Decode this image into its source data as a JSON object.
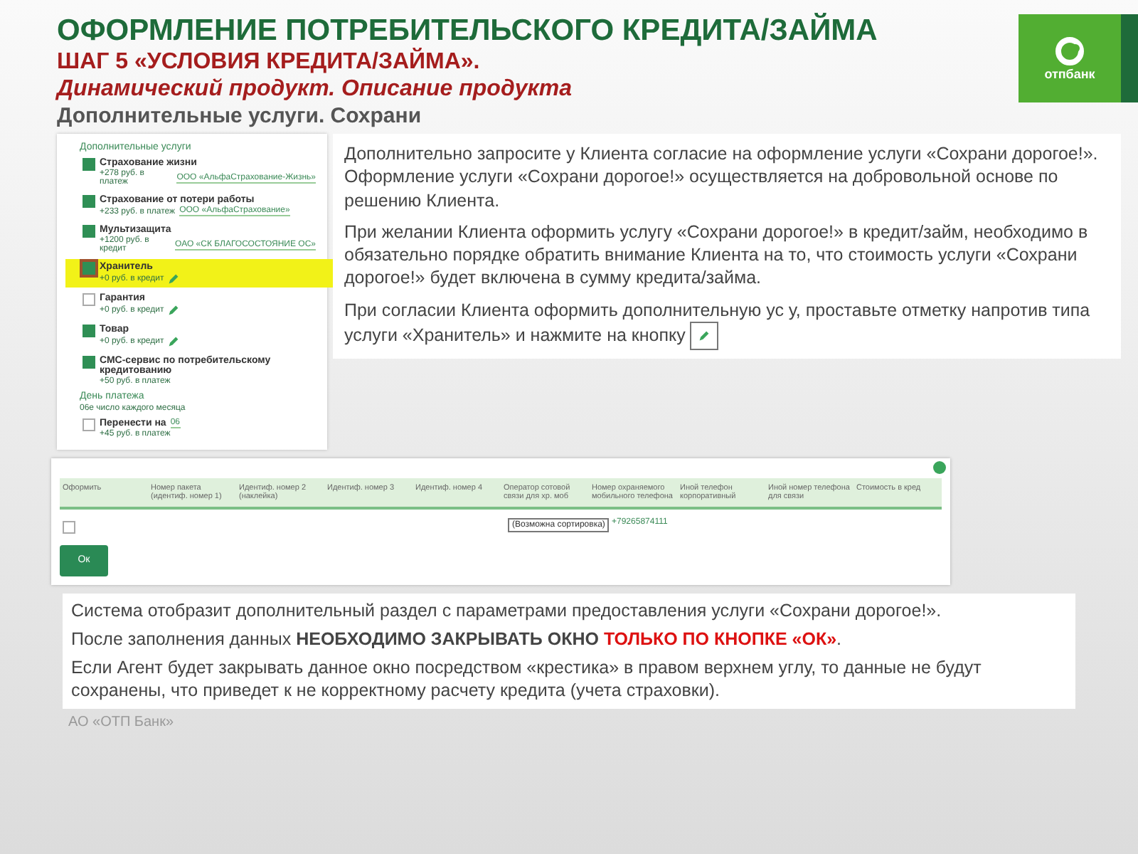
{
  "header": {
    "title": "ОФОРМЛЕНИЕ ПОТРЕБИТЕЛЬСКОГО КРЕДИТА/ЗАЙМА",
    "step": "ШАГ 5 «УСЛОВИЯ КРЕДИТА/ЗАЙМА».",
    "subtitle": "Динамический продукт. Описание продукта",
    "section": "Дополнительные услуги. Сохрани",
    "logo_text": "отпбанк"
  },
  "services_panel": {
    "heading": "Дополнительные услуги",
    "items": [
      {
        "name": "Страхование жизни",
        "price": "+278 руб. в платеж",
        "insurer": "ООО «АльфаСтрахование-Жизнь»",
        "checked": true,
        "highlighted": false,
        "editable": false
      },
      {
        "name": "Страхование от потери работы",
        "price": "+233 руб. в платеж",
        "insurer": "ООО «АльфаСтрахование»",
        "checked": true,
        "highlighted": false,
        "editable": false
      },
      {
        "name": "Мультизащита",
        "price": "+1200 руб. в кредит",
        "insurer": "ОАО «СК БЛАГОСОСТОЯНИЕ ОС»",
        "checked": true,
        "highlighted": false,
        "editable": false
      },
      {
        "name": "Хранитель",
        "price": "+0 руб. в кредит",
        "checked": true,
        "highlighted": true,
        "editable": true
      },
      {
        "name": "Гарантия",
        "price": "+0 руб. в кредит",
        "checked": false,
        "highlighted": false,
        "editable": true
      },
      {
        "name": "Товар",
        "price": "+0 руб. в кредит",
        "checked": true,
        "highlighted": false,
        "editable": true
      },
      {
        "name": "СМС-сервис по потребительскому кредитованию",
        "price": "+50 руб. в платеж",
        "checked": true,
        "highlighted": false,
        "editable": false
      }
    ],
    "payment_day": {
      "heading": "День платежа",
      "value": "06е число каждого месяца",
      "move_label": "Перенести на",
      "move_value": "06",
      "move_price": "+45 руб. в платеж",
      "checked": false
    }
  },
  "instructions": [
    "Дополнительно запросите у Клиента согласие на оформление услуги «Сохрани дорогое!». Оформление услуги «Сохрани дорогое!» осуществляется на добровольной основе по решению Клиента.",
    "При желании Клиента оформить услугу «Сохрани дорогое!» в кредит/займ, необходимо в обязательно порядке обратить  внимание Клиента на то, что стоимость услуги «Сохрани дорогое!» будет включена в сумму кредита/займа.",
    "При согласии Клиента оформить дополнительную ус у, проставьте отметку напротив типа услуги «Хранитель» и нажмите на кнопку"
  ],
  "dialog": {
    "columns": [
      "Оформить",
      "Номер пакета (идентиф. номер 1)",
      "Идентиф. номер 2 (наклейка)",
      "Идентиф. номер 3",
      "Идентиф. номер 4",
      "Оператор сотовой связи для хр. моб",
      "Номер охраняемого мобильного телефона",
      "Иной телефон корпоративный",
      "Иной номер телефона для связи",
      "Стоимость в кред"
    ],
    "row": {
      "checked": false,
      "tooltip": "(Возможна сортировка)",
      "phone": "+79265874111"
    },
    "ok_button": "Ок"
  },
  "notes": [
    "Система отобразит дополнительный раздел с параметрами предоставления услуги «Сохрани дорогое!».",
    "После заполнения данных **НЕОБХОДИМО ЗАКРЫВАТЬ ОКНО** ",
    "ТОЛЬКО ПО КНОПКЕ «ОК»",
    ".",
    "Если Агент будет закрывать данное окно посредством «крестика» в правом верхнем углу,  то данные не будут сохранены,  что приведет к не корректному расчету кредита (учета страховки)."
  ],
  "footer": "АО «ОТП Банк»"
}
